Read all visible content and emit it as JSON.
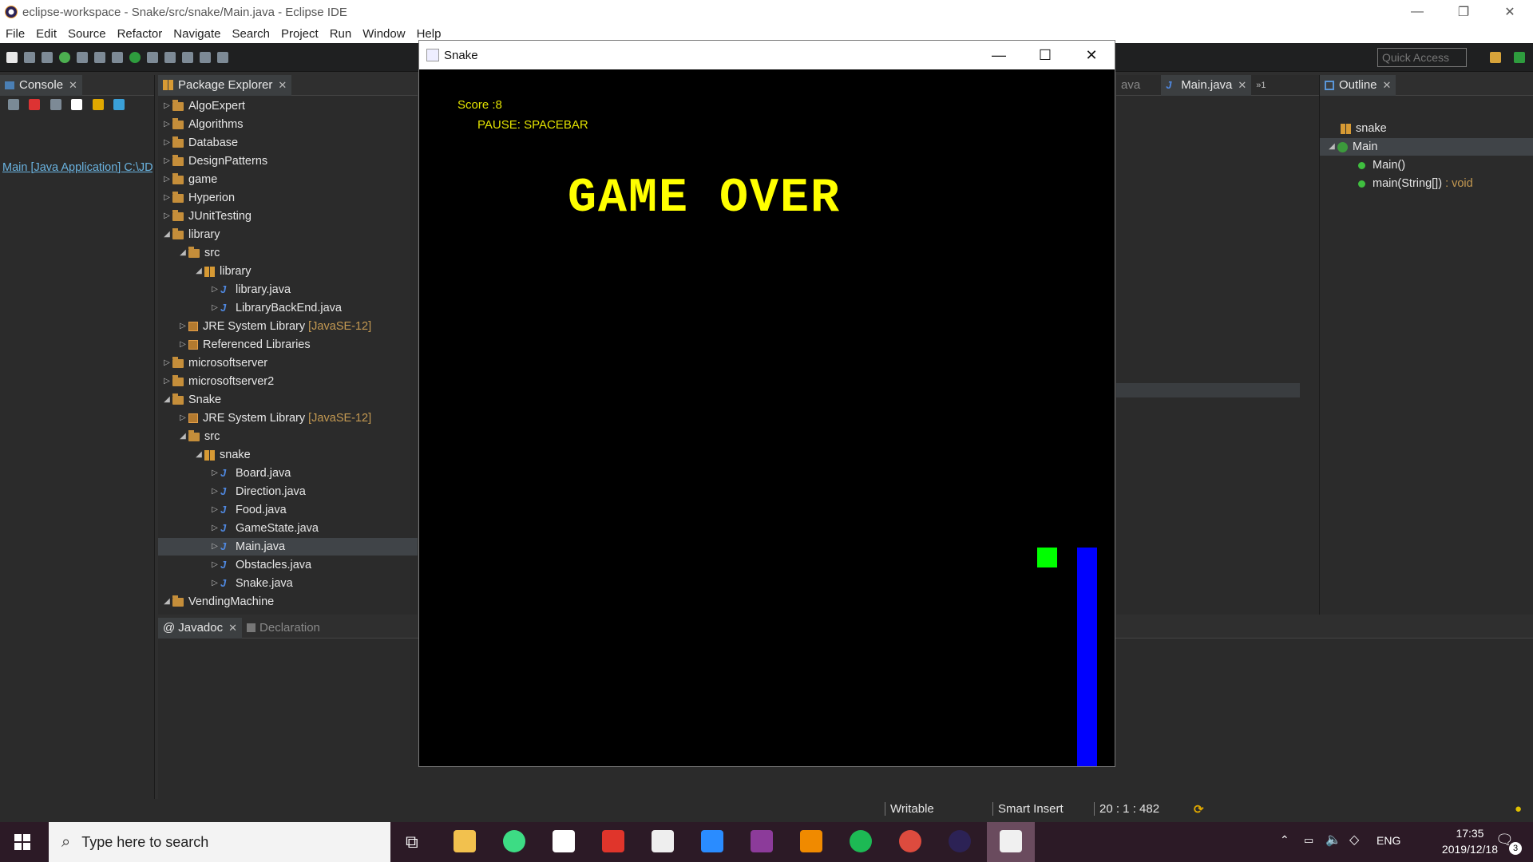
{
  "window": {
    "title": "eclipse-workspace - Snake/src/snake/Main.java - Eclipse IDE"
  },
  "menu": [
    "File",
    "Edit",
    "Source",
    "Refactor",
    "Navigate",
    "Search",
    "Project",
    "Run",
    "Window",
    "Help"
  ],
  "toolbar": {
    "quick_access_placeholder": "Quick Access"
  },
  "console": {
    "tab": "Console",
    "launch": "Main [Java Application] C:\\JD"
  },
  "package_explorer": {
    "tab": "Package Explorer",
    "items": [
      {
        "label": "AlgoExpert"
      },
      {
        "label": "Algorithms"
      },
      {
        "label": "Database"
      },
      {
        "label": "DesignPatterns"
      },
      {
        "label": "game"
      },
      {
        "label": "Hyperion"
      },
      {
        "label": "JUnitTesting"
      },
      {
        "label": "library"
      },
      {
        "label": "src"
      },
      {
        "label": "library"
      },
      {
        "label": "library.java"
      },
      {
        "label": "LibraryBackEnd.java"
      },
      {
        "label": "JRE System Library",
        "extra": "[JavaSE-12]"
      },
      {
        "label": "Referenced Libraries"
      },
      {
        "label": "microsoftserver"
      },
      {
        "label": "microsoftserver2"
      },
      {
        "label": "Snake"
      },
      {
        "label": "JRE System Library",
        "extra": "[JavaSE-12]"
      },
      {
        "label": "src"
      },
      {
        "label": "snake"
      },
      {
        "label": "Board.java"
      },
      {
        "label": "Direction.java"
      },
      {
        "label": "Food.java"
      },
      {
        "label": "GameState.java"
      },
      {
        "label": "Main.java"
      },
      {
        "label": "Obstacles.java"
      },
      {
        "label": "Snake.java"
      },
      {
        "label": "VendingMachine"
      }
    ]
  },
  "editor": {
    "tab_partial": "ava",
    "tab": "Main.java",
    "overflow": "1"
  },
  "outline": {
    "tab": "Outline",
    "package": "snake",
    "class": "Main",
    "constructor": "Main()",
    "method": "main(String[])",
    "method_type": ": void"
  },
  "bottom_tabs": {
    "javadoc": "Javadoc",
    "declaration": "Declaration"
  },
  "game": {
    "title": "Snake",
    "score": "Score :8",
    "pause": "PAUSE: SPACEBAR",
    "message": "GAME OVER",
    "food_color": "#00ff00",
    "snake_color": "#0000ff",
    "text_color": "#ffff00"
  },
  "status": {
    "writable": "Writable",
    "insert": "Smart Insert",
    "position": "20 : 1 : 482"
  },
  "taskbar": {
    "search_placeholder": "Type here to search",
    "lang": "ENG",
    "time": "17:35",
    "date": "2019/12/18",
    "notif_count": "3"
  }
}
